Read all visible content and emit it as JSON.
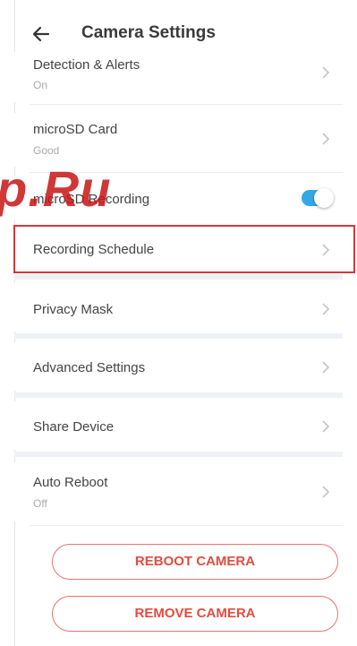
{
  "header": {
    "title": "Camera Settings"
  },
  "rows": [
    {
      "label": "Detection & Alerts",
      "sub": "On"
    },
    {
      "label": "microSD Card",
      "sub": "Good"
    },
    {
      "label": "microSD Recording"
    },
    {
      "label": "Recording Schedule"
    },
    {
      "label": "Privacy Mask"
    },
    {
      "label": "Advanced Settings"
    },
    {
      "label": "Share Device"
    },
    {
      "label": "Auto Reboot",
      "sub": "Off"
    }
  ],
  "toggle_on": true,
  "buttons": {
    "reboot": "REBOOT CAMERA",
    "remove": "REMOVE CAMERA"
  },
  "watermark": "p.Ru",
  "colors": {
    "accent": "#34a7e6",
    "danger": "#e24d41",
    "highlight": "#d33a3a"
  }
}
